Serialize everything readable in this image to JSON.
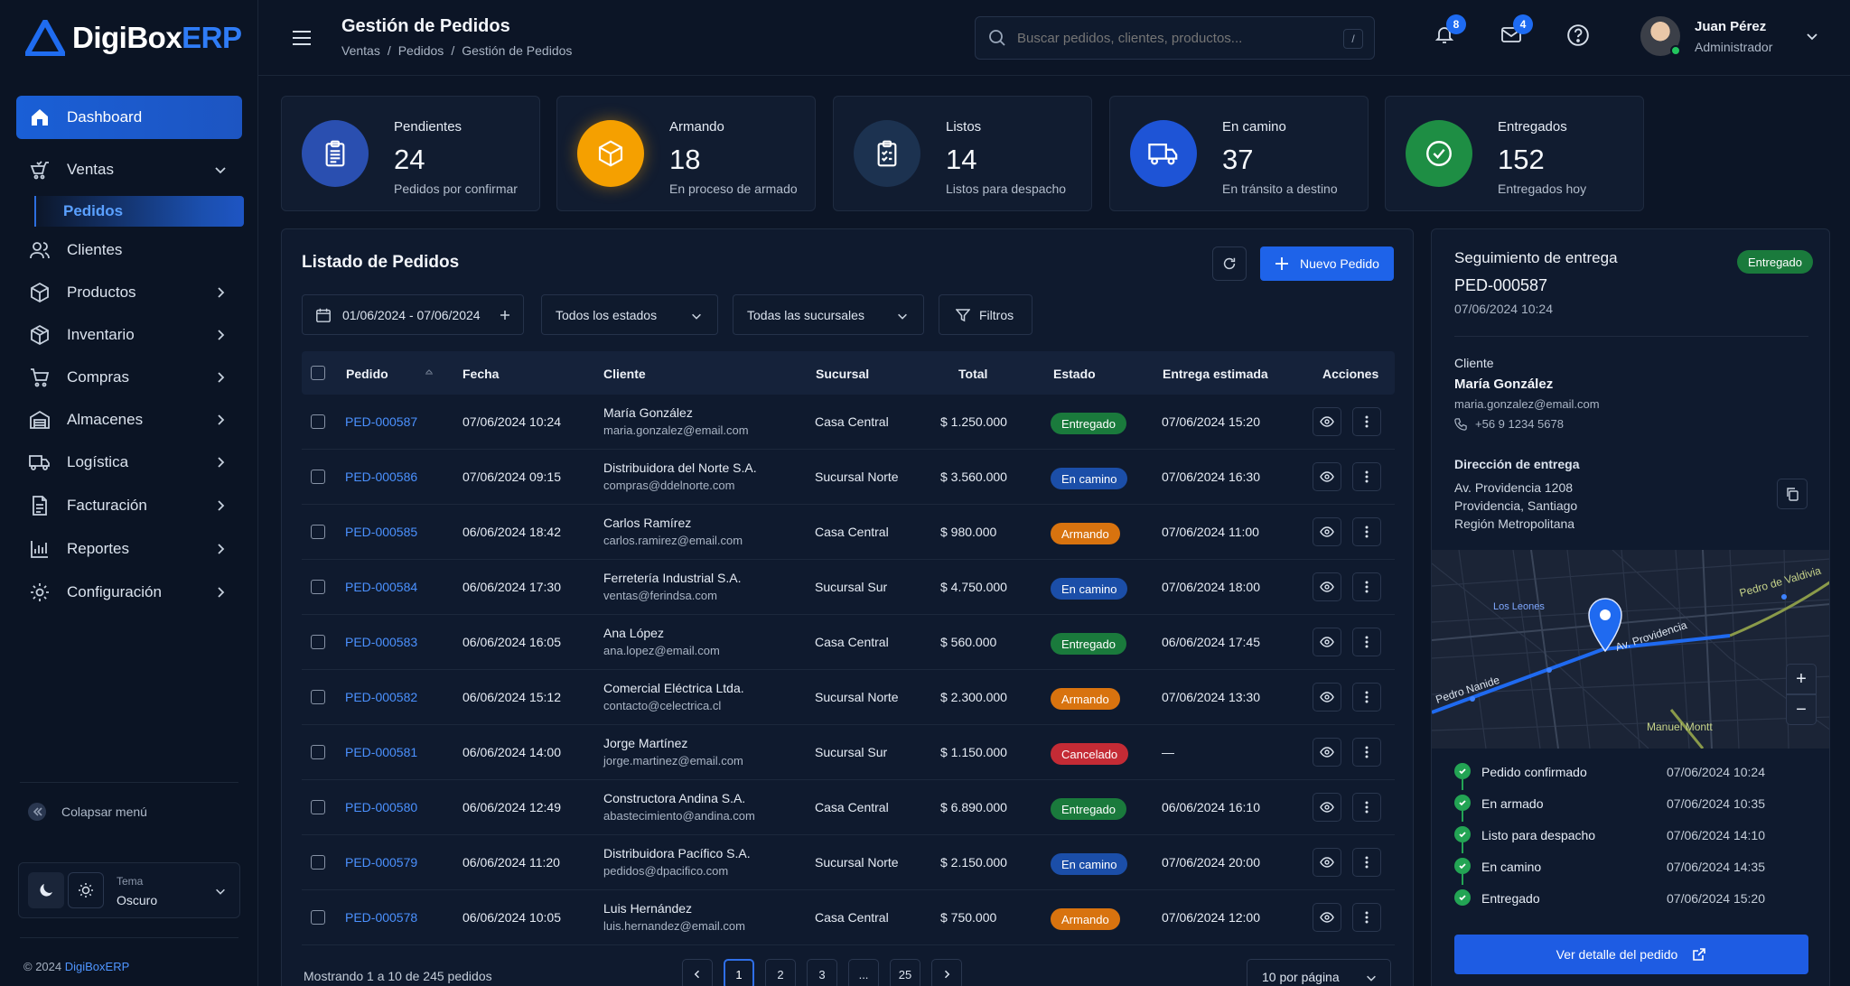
{
  "brand": {
    "name_main": "DigiBox",
    "name_accent": "ERP"
  },
  "header": {
    "title": "Gestión de Pedidos",
    "breadcrumb": [
      "Ventas",
      "Pedidos",
      "Gestión de Pedidos"
    ],
    "breadcrumb_sep": "/",
    "search_placeholder": "Buscar pedidos, clientes, productos...",
    "search_shortcut": "/",
    "notifications_count": "8",
    "messages_count": "4",
    "user_name": "Juan Pérez",
    "user_role": "Administrador"
  },
  "sidebar": {
    "items": [
      {
        "label": "Dashboard",
        "icon": "home-icon"
      },
      {
        "label": "Ventas",
        "icon": "cart-icon"
      },
      {
        "label": "Clientes",
        "icon": "users-icon"
      },
      {
        "label": "Productos",
        "icon": "box-icon"
      },
      {
        "label": "Inventario",
        "icon": "package-icon"
      },
      {
        "label": "Compras",
        "icon": "shopping-cart-icon"
      },
      {
        "label": "Almacenes",
        "icon": "warehouse-icon"
      },
      {
        "label": "Logística",
        "icon": "truck-icon"
      },
      {
        "label": "Facturación",
        "icon": "invoice-icon"
      },
      {
        "label": "Reportes",
        "icon": "bar-chart-icon"
      },
      {
        "label": "Configuración",
        "icon": "gear-icon"
      }
    ],
    "sub_item": "Pedidos",
    "collapse_label": "Colapsar menú",
    "theme_label": "Tema",
    "theme_value": "Oscuro",
    "copyright_prefix": "© 2024 ",
    "copyright_brand": "DigiBoxERP"
  },
  "kpis": [
    {
      "label": "Pendientes",
      "value": "24",
      "sub": "Pedidos por confirmar",
      "color": "#2a4fb0",
      "icon": "clipboard-icon"
    },
    {
      "label": "Armando",
      "value": "18",
      "sub": "En proceso de armado",
      "color": "#f5a000",
      "icon": "box-icon"
    },
    {
      "label": "Listos",
      "value": "14",
      "sub": "Listos para despacho",
      "color": "#1c3250",
      "icon": "checklist-icon"
    },
    {
      "label": "En camino",
      "value": "37",
      "sub": "En tránsito a destino",
      "color": "#1e54d6",
      "icon": "truck-icon"
    },
    {
      "label": "Entregados",
      "value": "152",
      "sub": "Entregados hoy",
      "color": "#1e8e44",
      "icon": "check-circle-icon"
    }
  ],
  "orders": {
    "title": "Listado de Pedidos",
    "new_button": "Nuevo Pedido",
    "filters": {
      "date_range": "01/06/2024 - 07/06/2024",
      "status": "Todos los estados",
      "branch": "Todas las sucursales",
      "more": "Filtros"
    },
    "columns": [
      "Pedido",
      "Fecha",
      "Cliente",
      "Sucursal",
      "Total",
      "Estado",
      "Entrega estimada",
      "Acciones"
    ],
    "rows": [
      {
        "id": "PED-000587",
        "date": "07/06/2024 10:24",
        "client": "María González",
        "email": "maria.gonzalez@email.com",
        "branch": "Casa Central",
        "total": "$ 1.250.000",
        "status": "Entregado",
        "eta": "07/06/2024 15:20"
      },
      {
        "id": "PED-000586",
        "date": "07/06/2024 09:15",
        "client": "Distribuidora del Norte S.A.",
        "email": "compras@ddelnorte.com",
        "branch": "Sucursal Norte",
        "total": "$ 3.560.000",
        "status": "En camino",
        "eta": "07/06/2024 16:30"
      },
      {
        "id": "PED-000585",
        "date": "06/06/2024 18:42",
        "client": "Carlos Ramírez",
        "email": "carlos.ramirez@email.com",
        "branch": "Casa Central",
        "total": "$ 980.000",
        "status": "Armando",
        "eta": "07/06/2024 11:00"
      },
      {
        "id": "PED-000584",
        "date": "06/06/2024 17:30",
        "client": "Ferretería Industrial S.A.",
        "email": "ventas@ferindsa.com",
        "branch": "Sucursal Sur",
        "total": "$ 4.750.000",
        "status": "En camino",
        "eta": "07/06/2024 18:00"
      },
      {
        "id": "PED-000583",
        "date": "06/06/2024 16:05",
        "client": "Ana López",
        "email": "ana.lopez@email.com",
        "branch": "Casa Central",
        "total": "$ 560.000",
        "status": "Entregado",
        "eta": "06/06/2024 17:45"
      },
      {
        "id": "PED-000582",
        "date": "06/06/2024 15:12",
        "client": "Comercial Eléctrica Ltda.",
        "email": "contacto@celectrica.cl",
        "branch": "Sucursal Norte",
        "total": "$ 2.300.000",
        "status": "Armando",
        "eta": "07/06/2024 13:30"
      },
      {
        "id": "PED-000581",
        "date": "06/06/2024 14:00",
        "client": "Jorge Martínez",
        "email": "jorge.martinez@email.com",
        "branch": "Sucursal Sur",
        "total": "$ 1.150.000",
        "status": "Cancelado",
        "eta": "—"
      },
      {
        "id": "PED-000580",
        "date": "06/06/2024 12:49",
        "client": "Constructora Andina S.A.",
        "email": "abastecimiento@andina.com",
        "branch": "Casa Central",
        "total": "$ 6.890.000",
        "status": "Entregado",
        "eta": "06/06/2024 16:10"
      },
      {
        "id": "PED-000579",
        "date": "06/06/2024 11:20",
        "client": "Distribuidora Pacífico S.A.",
        "email": "pedidos@dpacifico.com",
        "branch": "Sucursal Norte",
        "total": "$ 2.150.000",
        "status": "En camino",
        "eta": "07/06/2024 20:00"
      },
      {
        "id": "PED-000578",
        "date": "06/06/2024 10:05",
        "client": "Luis Hernández",
        "email": "luis.hernandez@email.com",
        "branch": "Casa Central",
        "total": "$ 750.000",
        "status": "Armando",
        "eta": "07/06/2024 12:00"
      }
    ],
    "status_colors": {
      "Entregado": "#1a7a3c",
      "En camino": "#1b4ea8",
      "Armando": "#d8730f",
      "Cancelado": "#c42b35"
    },
    "pagination": {
      "info": "Mostrando 1 a 10 de 245 pedidos",
      "pages": [
        "1",
        "2",
        "3",
        "...",
        "25"
      ],
      "per_page": "10 por página"
    }
  },
  "tracking": {
    "title": "Seguimiento de entrega",
    "badge": "Entregado",
    "order_id": "PED-000587",
    "order_date": "07/06/2024 10:24",
    "client_label": "Cliente",
    "client_name": "María González",
    "client_email": "maria.gonzalez@email.com",
    "client_phone": "+56 9 1234 5678",
    "address_label": "Dirección de entrega",
    "address_lines": [
      "Av. Providencia 1208",
      "Providencia, Santiago",
      "Región Metropolitana"
    ],
    "map_labels": {
      "los_leones": "Los Leones",
      "providencia": "Av. Providencia",
      "pedro_valdivia": "Pedro de Valdivia",
      "pedro_nanide": "Pedro Nanide",
      "manuel_montt": "Manuel Montt"
    },
    "map_zoom_in": "+",
    "map_zoom_out": "−",
    "timeline": [
      {
        "label": "Pedido confirmado",
        "time": "07/06/2024 10:24"
      },
      {
        "label": "En armado",
        "time": "07/06/2024 10:35"
      },
      {
        "label": "Listo para despacho",
        "time": "07/06/2024 14:10"
      },
      {
        "label": "En camino",
        "time": "07/06/2024 14:35"
      },
      {
        "label": "Entregado",
        "time": "07/06/2024 15:20"
      }
    ],
    "detail_button": "Ver detalle del pedido"
  }
}
